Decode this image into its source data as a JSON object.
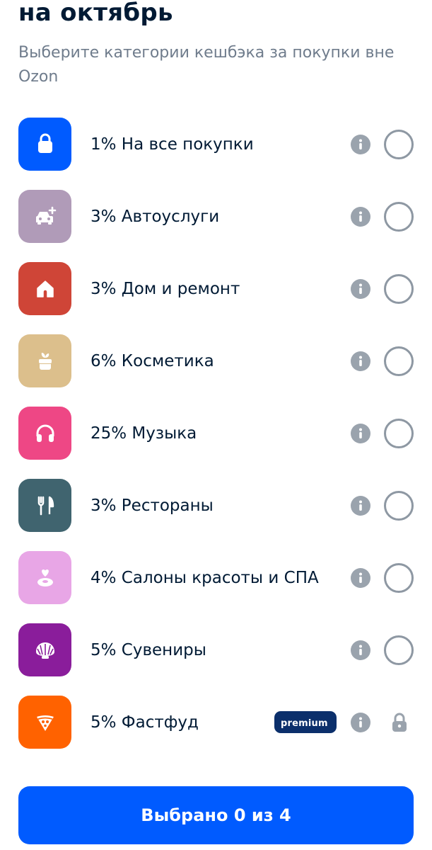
{
  "header": {
    "title": "на октябрь",
    "subtitle": "Выберите категории кешбэка за покупки вне Ozon"
  },
  "categories": [
    {
      "label": "1% На все покупки",
      "color": "#005bff",
      "icon": "shopping-bag-icon",
      "selected": false
    },
    {
      "label": "3% Автоуслуги",
      "color": "#b09bb8",
      "icon": "car-plus-icon",
      "selected": false
    },
    {
      "label": "3% Дом и ремонт",
      "color": "#cf4537",
      "icon": "house-icon",
      "selected": false
    },
    {
      "label": "6% Косметика",
      "color": "#dcbf8c",
      "icon": "cosmetics-jar-icon",
      "selected": false
    },
    {
      "label": "25% Музыка",
      "color": "#ee4785",
      "icon": "headphones-icon",
      "selected": false
    },
    {
      "label": "3% Рестораны",
      "color": "#40646f",
      "icon": "fork-knife-icon",
      "selected": false
    },
    {
      "label": "4% Салоны красоты и СПА",
      "color": "#e8a6e6",
      "icon": "spa-icon",
      "selected": false
    },
    {
      "label": "5% Сувениры",
      "color": "#8a1d9b",
      "icon": "shell-icon",
      "selected": false
    },
    {
      "label": "5% Фастфуд",
      "color": "#ff6200",
      "icon": "pizza-icon",
      "selected": false,
      "locked": true,
      "badge": "premium"
    }
  ],
  "cta": {
    "label": "Выбрано 0 из 4"
  }
}
